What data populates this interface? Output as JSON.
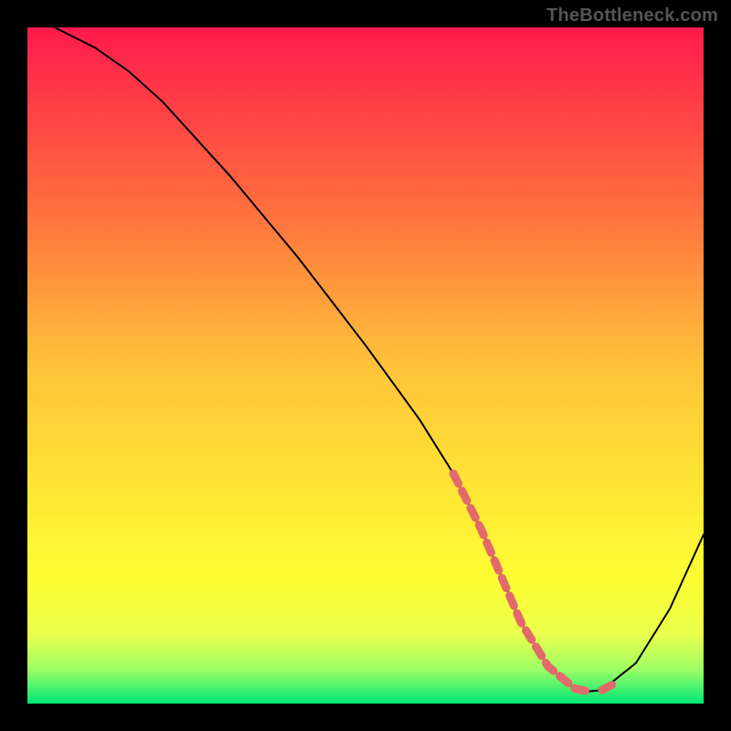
{
  "watermark": "TheBottleneck.com",
  "chart_data": {
    "type": "line",
    "title": "",
    "xlabel": "",
    "ylabel": "",
    "xlim": [
      0,
      100
    ],
    "ylim": [
      0,
      100
    ],
    "grid": false,
    "background_gradient": {
      "stops": [
        {
          "offset": 0.0,
          "color": "#ff1a4d"
        },
        {
          "offset": 0.25,
          "color": "#ff693f"
        },
        {
          "offset": 0.5,
          "color": "#ffc23a"
        },
        {
          "offset": 0.7,
          "color": "#fee934"
        },
        {
          "offset": 0.82,
          "color": "#feff33"
        },
        {
          "offset": 0.9,
          "color": "#e7ff4d"
        },
        {
          "offset": 0.95,
          "color": "#9cff66"
        },
        {
          "offset": 1.0,
          "color": "#00e676"
        }
      ]
    },
    "series": [
      {
        "name": "curve",
        "color": "#000000",
        "stroke_width": 2,
        "x": [
          4,
          10,
          15,
          20,
          30,
          40,
          50,
          58,
          63,
          67,
          70,
          73,
          77,
          81,
          83,
          85,
          90,
          95,
          100
        ],
        "y": [
          100,
          97,
          93.5,
          89,
          78,
          66,
          53,
          42,
          34,
          26,
          19,
          12,
          5.5,
          2.2,
          1.8,
          2.0,
          6,
          14,
          25
        ]
      },
      {
        "name": "highlight-band",
        "color": "#e26a6a",
        "type": "band",
        "segments": [
          {
            "x": [
              63,
              67,
              70,
              73,
              77,
              81,
              83
            ],
            "y": [
              34,
              26,
              19,
              12,
              5.5,
              2.2,
              1.8
            ]
          },
          {
            "x": [
              85,
              86.5
            ],
            "y": [
              2.0,
              2.8
            ]
          }
        ]
      }
    ]
  }
}
